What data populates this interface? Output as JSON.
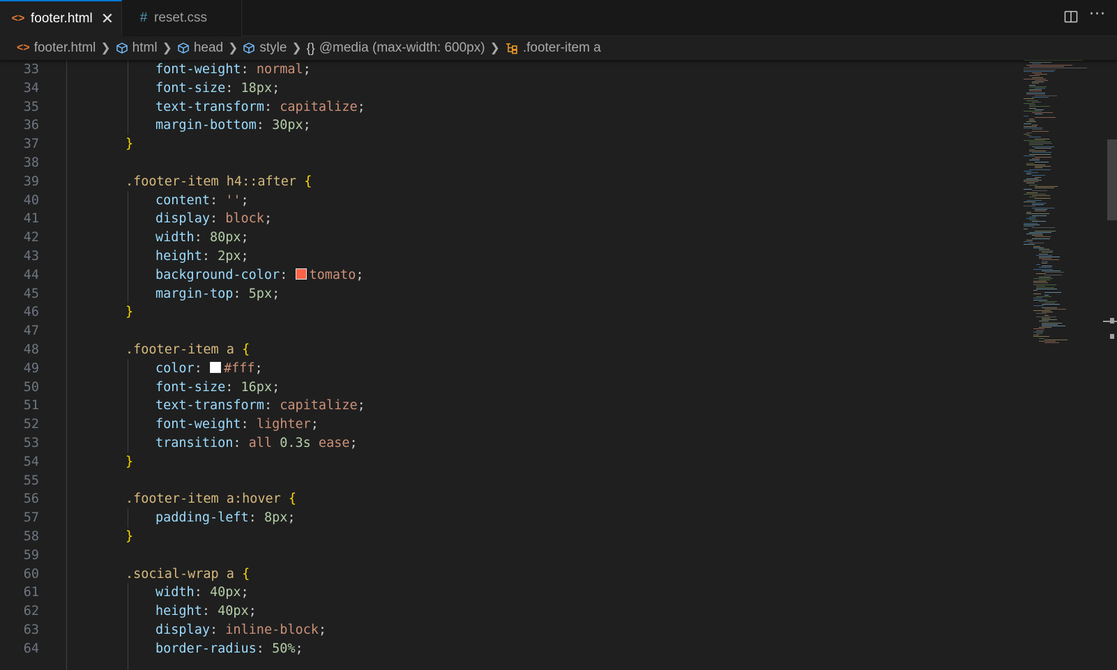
{
  "tabs": [
    {
      "label": "footer.html",
      "icon": "html-file-icon",
      "active": true
    },
    {
      "label": "reset.css",
      "icon": "css-hash-icon",
      "active": false
    }
  ],
  "tab_actions": {
    "split_icon": "split-editor-icon",
    "more_icon": "more-actions-icon"
  },
  "breadcrumb": {
    "file": "footer.html",
    "html": "html",
    "head": "head",
    "style": "style",
    "media": "@media (max-width: 600px)",
    "selector": ".footer-item a"
  },
  "colors": {
    "accent": "#0078d4",
    "html_icon": "#e37933",
    "css_icon": "#519aba",
    "tomato_swatch": "#ff6347",
    "white_swatch": "#ffffff"
  },
  "lines": [
    {
      "n": "33",
      "indent": 2,
      "tokens": [
        [
          "p",
          "font-weight"
        ],
        [
          "c",
          ": "
        ],
        [
          "v",
          "normal"
        ],
        [
          "c",
          ";"
        ]
      ]
    },
    {
      "n": "34",
      "indent": 2,
      "tokens": [
        [
          "p",
          "font-size"
        ],
        [
          "c",
          ": "
        ],
        [
          "n",
          "18px"
        ],
        [
          "c",
          ";"
        ]
      ]
    },
    {
      "n": "35",
      "indent": 2,
      "tokens": [
        [
          "p",
          "text-transform"
        ],
        [
          "c",
          ": "
        ],
        [
          "v",
          "capitalize"
        ],
        [
          "c",
          ";"
        ]
      ]
    },
    {
      "n": "36",
      "indent": 2,
      "tokens": [
        [
          "p",
          "margin-bottom"
        ],
        [
          "c",
          ": "
        ],
        [
          "n",
          "30px"
        ],
        [
          "c",
          ";"
        ]
      ]
    },
    {
      "n": "37",
      "indent": 1,
      "tokens": [
        [
          "b",
          "}"
        ]
      ]
    },
    {
      "n": "38",
      "indent": 0,
      "tokens": []
    },
    {
      "n": "39",
      "indent": 1,
      "tokens": [
        [
          "s",
          ".footer-item h4::after"
        ],
        [
          "c",
          " "
        ],
        [
          "b",
          "{"
        ]
      ]
    },
    {
      "n": "40",
      "indent": 2,
      "tokens": [
        [
          "p",
          "content"
        ],
        [
          "c",
          ": "
        ],
        [
          "v",
          "''"
        ],
        [
          "c",
          ";"
        ]
      ]
    },
    {
      "n": "41",
      "indent": 2,
      "tokens": [
        [
          "p",
          "display"
        ],
        [
          "c",
          ": "
        ],
        [
          "v",
          "block"
        ],
        [
          "c",
          ";"
        ]
      ]
    },
    {
      "n": "42",
      "indent": 2,
      "tokens": [
        [
          "p",
          "width"
        ],
        [
          "c",
          ": "
        ],
        [
          "n",
          "80px"
        ],
        [
          "c",
          ";"
        ]
      ]
    },
    {
      "n": "43",
      "indent": 2,
      "tokens": [
        [
          "p",
          "height"
        ],
        [
          "c",
          ": "
        ],
        [
          "n",
          "2px"
        ],
        [
          "c",
          ";"
        ]
      ]
    },
    {
      "n": "44",
      "indent": 2,
      "tokens": [
        [
          "p",
          "background-color"
        ],
        [
          "c",
          ": "
        ],
        [
          "sw",
          "#ff6347"
        ],
        [
          "v",
          "tomato"
        ],
        [
          "c",
          ";"
        ]
      ]
    },
    {
      "n": "45",
      "indent": 2,
      "tokens": [
        [
          "p",
          "margin-top"
        ],
        [
          "c",
          ": "
        ],
        [
          "n",
          "5px"
        ],
        [
          "c",
          ";"
        ]
      ]
    },
    {
      "n": "46",
      "indent": 1,
      "tokens": [
        [
          "b",
          "}"
        ]
      ]
    },
    {
      "n": "47",
      "indent": 0,
      "tokens": []
    },
    {
      "n": "48",
      "indent": 1,
      "tokens": [
        [
          "s",
          ".footer-item a"
        ],
        [
          "c",
          " "
        ],
        [
          "b",
          "{"
        ]
      ]
    },
    {
      "n": "49",
      "indent": 2,
      "tokens": [
        [
          "p",
          "color"
        ],
        [
          "c",
          ": "
        ],
        [
          "sw",
          "#ffffff"
        ],
        [
          "v",
          "#fff"
        ],
        [
          "c",
          ";"
        ]
      ]
    },
    {
      "n": "50",
      "indent": 2,
      "tokens": [
        [
          "p",
          "font-size"
        ],
        [
          "c",
          ": "
        ],
        [
          "n",
          "16px"
        ],
        [
          "c",
          ";"
        ]
      ]
    },
    {
      "n": "51",
      "indent": 2,
      "tokens": [
        [
          "p",
          "text-transform"
        ],
        [
          "c",
          ": "
        ],
        [
          "v",
          "capitalize"
        ],
        [
          "c",
          ";"
        ]
      ]
    },
    {
      "n": "52",
      "indent": 2,
      "tokens": [
        [
          "p",
          "font-weight"
        ],
        [
          "c",
          ": "
        ],
        [
          "v",
          "lighter"
        ],
        [
          "c",
          ";"
        ]
      ]
    },
    {
      "n": "53",
      "indent": 2,
      "tokens": [
        [
          "p",
          "transition"
        ],
        [
          "c",
          ": "
        ],
        [
          "v",
          "all "
        ],
        [
          "n",
          "0.3s"
        ],
        [
          "v",
          " ease"
        ],
        [
          "c",
          ";"
        ]
      ]
    },
    {
      "n": "54",
      "indent": 1,
      "tokens": [
        [
          "b",
          "}"
        ]
      ]
    },
    {
      "n": "55",
      "indent": 0,
      "tokens": []
    },
    {
      "n": "56",
      "indent": 1,
      "tokens": [
        [
          "s",
          ".footer-item a:hover"
        ],
        [
          "c",
          " "
        ],
        [
          "b",
          "{"
        ]
      ]
    },
    {
      "n": "57",
      "indent": 2,
      "tokens": [
        [
          "p",
          "padding-left"
        ],
        [
          "c",
          ": "
        ],
        [
          "n",
          "8px"
        ],
        [
          "c",
          ";"
        ]
      ]
    },
    {
      "n": "58",
      "indent": 1,
      "tokens": [
        [
          "b",
          "}"
        ]
      ]
    },
    {
      "n": "59",
      "indent": 0,
      "tokens": []
    },
    {
      "n": "60",
      "indent": 1,
      "tokens": [
        [
          "s",
          ".social-wrap a"
        ],
        [
          "c",
          " "
        ],
        [
          "b",
          "{"
        ]
      ]
    },
    {
      "n": "61",
      "indent": 2,
      "tokens": [
        [
          "p",
          "width"
        ],
        [
          "c",
          ": "
        ],
        [
          "n",
          "40px"
        ],
        [
          "c",
          ";"
        ]
      ]
    },
    {
      "n": "62",
      "indent": 2,
      "tokens": [
        [
          "p",
          "height"
        ],
        [
          "c",
          ": "
        ],
        [
          "n",
          "40px"
        ],
        [
          "c",
          ";"
        ]
      ]
    },
    {
      "n": "63",
      "indent": 2,
      "tokens": [
        [
          "p",
          "display"
        ],
        [
          "c",
          ": "
        ],
        [
          "v",
          "inline-block"
        ],
        [
          "c",
          ";"
        ]
      ]
    },
    {
      "n": "64",
      "indent": 2,
      "tokens": [
        [
          "p",
          "border-radius"
        ],
        [
          "c",
          ": "
        ],
        [
          "n",
          "50%"
        ],
        [
          "c",
          ";"
        ]
      ]
    }
  ]
}
